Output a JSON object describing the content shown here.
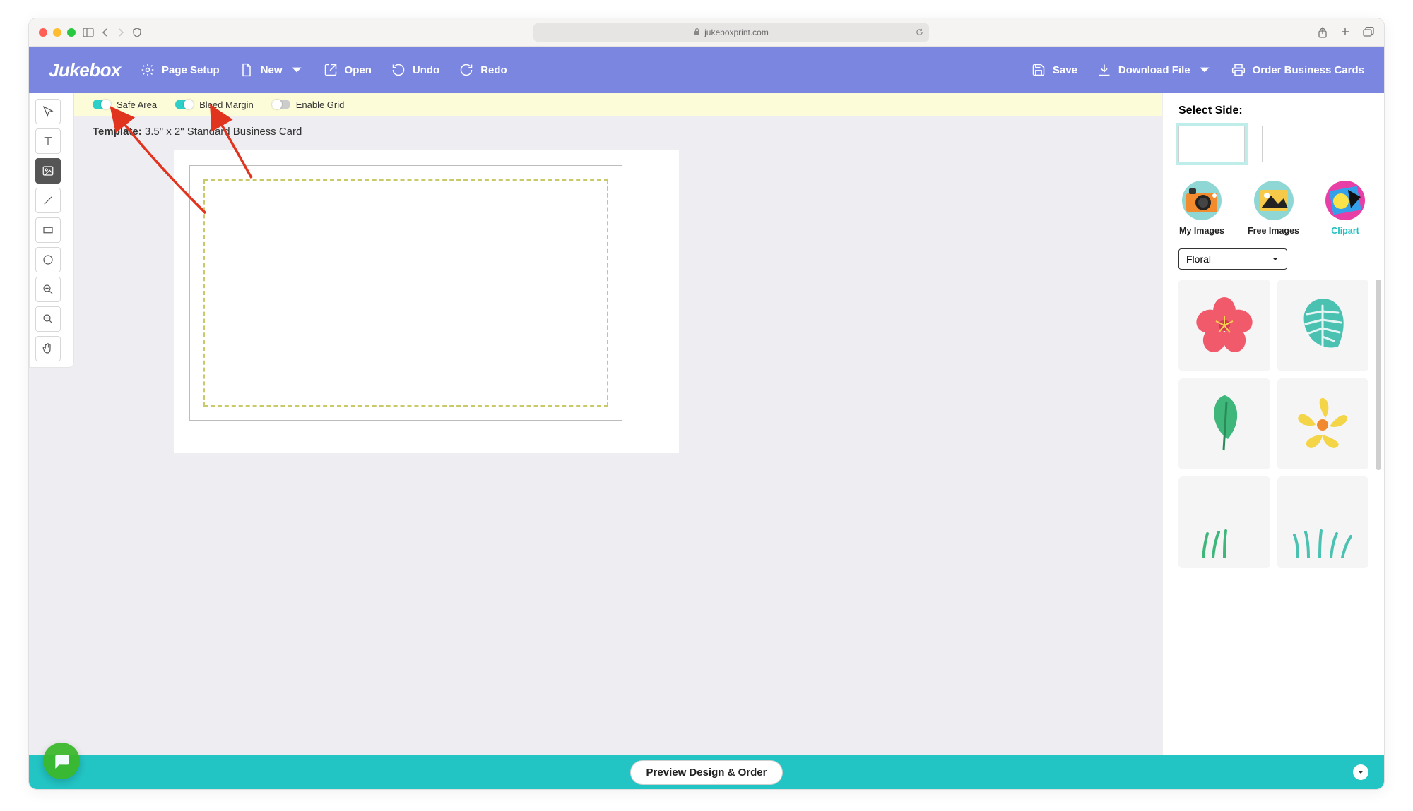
{
  "browser": {
    "url": "jukeboxprint.com"
  },
  "brand": {
    "name": "Jukebox"
  },
  "toolbar": {
    "page_setup": "Page Setup",
    "new": "New",
    "open": "Open",
    "undo": "Undo",
    "redo": "Redo",
    "save": "Save",
    "download": "Download File",
    "order": "Order Business Cards"
  },
  "toggles": {
    "safe_area": {
      "label": "Safe Area",
      "on": true
    },
    "bleed_margin": {
      "label": "Bleed Margin",
      "on": true
    },
    "enable_grid": {
      "label": "Enable Grid",
      "on": false
    }
  },
  "template": {
    "prefix": "Template:",
    "value": "3.5\" x 2\" Standard Business Card"
  },
  "rail": {
    "select": "select-tool",
    "text": "text-tool",
    "image": "image-tool",
    "line": "line-tool",
    "rect": "rectangle-tool",
    "circle": "circle-tool",
    "zoom_in": "zoom-in-tool",
    "zoom_out": "zoom-out-tool",
    "pan": "pan-tool",
    "active": "image"
  },
  "sidepanel": {
    "select_side": "Select Side:",
    "sides": {
      "front_selected": true
    },
    "tabs": {
      "my_images": "My Images",
      "free_images": "Free Images",
      "clipart": "Clipart",
      "active": "clipart"
    },
    "category": {
      "selected": "Floral"
    },
    "clipart_items": [
      "hibiscus-flower-pink",
      "monstera-leaf-teal",
      "leaf-green",
      "plumeria-flower-yellow",
      "grass-sprout-1",
      "grass-sprout-2"
    ]
  },
  "bottom": {
    "preview_order": "Preview Design & Order"
  },
  "colors": {
    "toolbar": "#7b86e0",
    "teal_bar": "#23c4c4",
    "toggle_on": "#2dd0c9",
    "chat": "#3cb82d",
    "annotation": "#e1341e"
  }
}
